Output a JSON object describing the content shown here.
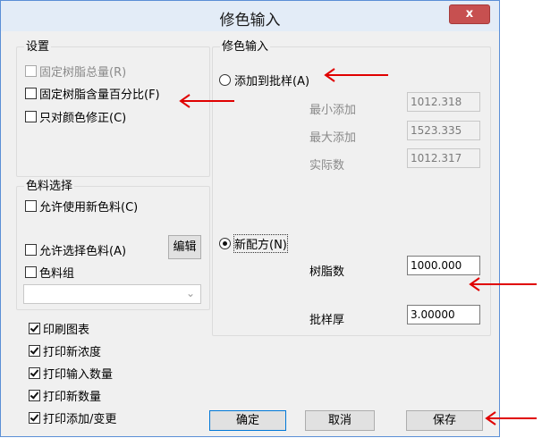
{
  "window": {
    "title": "修色输入",
    "close_label": "x"
  },
  "settings": {
    "legend": "设置",
    "options": [
      {
        "label": "固定树脂总量(R)",
        "checked": false,
        "enabled": false
      },
      {
        "label": "固定树脂含量百分比(F)",
        "checked": false,
        "enabled": true
      },
      {
        "label": "只对颜色修正(C)",
        "checked": false,
        "enabled": true
      }
    ]
  },
  "colorant": {
    "legend": "色料选择",
    "allow_new": "允许使用新色料(C)",
    "allow_select": "允许选择色料(A)",
    "edit_button": "编辑",
    "colorant_group": "色料组",
    "combo_value": ""
  },
  "print_options": [
    {
      "label": "印刷图表",
      "checked": true
    },
    {
      "label": "打印新浓度",
      "checked": true
    },
    {
      "label": "打印输入数量",
      "checked": true
    },
    {
      "label": "打印新数量",
      "checked": true
    },
    {
      "label": "打印添加/变更",
      "checked": true
    }
  ],
  "correction": {
    "legend": "修色输入",
    "add_to_batch": {
      "label": "添加到批样(A)",
      "selected": false
    },
    "min_add": {
      "label": "最小添加",
      "value": "1012.318"
    },
    "max_add": {
      "label": "最大添加",
      "value": "1523.335"
    },
    "actual": {
      "label": "实际数",
      "value": "1012.317"
    },
    "new_formula": {
      "label": "新配方(N)",
      "selected": true
    },
    "resin": {
      "label": "树脂数",
      "value": "1000.000"
    },
    "batch_thickness": {
      "label": "批样厚",
      "value": "3.00000"
    }
  },
  "buttons": {
    "ok": "确定",
    "cancel": "取消",
    "save": "保存"
  },
  "annotation_color": "#e00000"
}
